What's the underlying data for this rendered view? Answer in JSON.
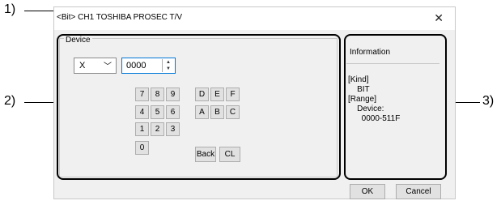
{
  "callouts": {
    "c1": "1)",
    "c2": "2)",
    "c3": "3)"
  },
  "dialog": {
    "title": "<Bit> CH1 TOSHIBA PROSEC T/V",
    "close_glyph": "✕",
    "device": {
      "group_label": "Device",
      "type_value": "X",
      "number_value": "0000",
      "keys_num": [
        "7",
        "8",
        "9",
        "4",
        "5",
        "6",
        "1",
        "2",
        "3",
        "0"
      ],
      "keys_hex": [
        "D",
        "E",
        "F",
        "A",
        "B",
        "C"
      ],
      "back_label": "Back",
      "clear_label": "CL"
    },
    "information": {
      "label": "Information",
      "text": "[Kind]\n    BIT\n[Range]\n    Device:\n      0000-511F"
    },
    "ok_label": "OK",
    "cancel_label": "Cancel"
  }
}
